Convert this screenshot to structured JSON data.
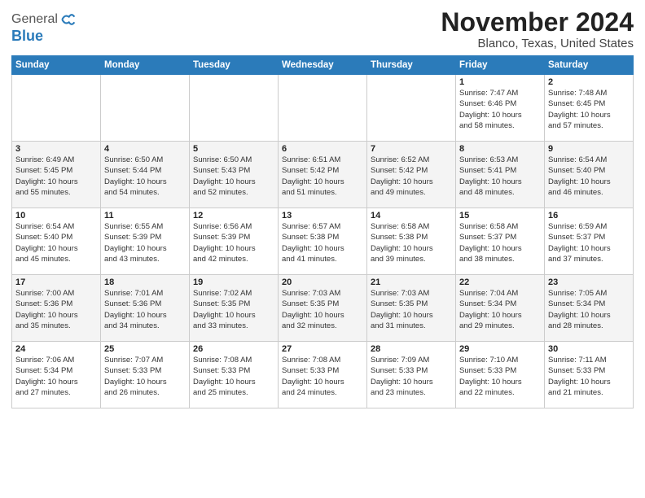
{
  "logo": {
    "general": "General",
    "blue": "Blue"
  },
  "title": "November 2024",
  "subtitle": "Blanco, Texas, United States",
  "headers": [
    "Sunday",
    "Monday",
    "Tuesday",
    "Wednesday",
    "Thursday",
    "Friday",
    "Saturday"
  ],
  "weeks": [
    [
      {
        "day": "",
        "info": ""
      },
      {
        "day": "",
        "info": ""
      },
      {
        "day": "",
        "info": ""
      },
      {
        "day": "",
        "info": ""
      },
      {
        "day": "",
        "info": ""
      },
      {
        "day": "1",
        "info": "Sunrise: 7:47 AM\nSunset: 6:46 PM\nDaylight: 10 hours\nand 58 minutes."
      },
      {
        "day": "2",
        "info": "Sunrise: 7:48 AM\nSunset: 6:45 PM\nDaylight: 10 hours\nand 57 minutes."
      }
    ],
    [
      {
        "day": "3",
        "info": "Sunrise: 6:49 AM\nSunset: 5:45 PM\nDaylight: 10 hours\nand 55 minutes."
      },
      {
        "day": "4",
        "info": "Sunrise: 6:50 AM\nSunset: 5:44 PM\nDaylight: 10 hours\nand 54 minutes."
      },
      {
        "day": "5",
        "info": "Sunrise: 6:50 AM\nSunset: 5:43 PM\nDaylight: 10 hours\nand 52 minutes."
      },
      {
        "day": "6",
        "info": "Sunrise: 6:51 AM\nSunset: 5:42 PM\nDaylight: 10 hours\nand 51 minutes."
      },
      {
        "day": "7",
        "info": "Sunrise: 6:52 AM\nSunset: 5:42 PM\nDaylight: 10 hours\nand 49 minutes."
      },
      {
        "day": "8",
        "info": "Sunrise: 6:53 AM\nSunset: 5:41 PM\nDaylight: 10 hours\nand 48 minutes."
      },
      {
        "day": "9",
        "info": "Sunrise: 6:54 AM\nSunset: 5:40 PM\nDaylight: 10 hours\nand 46 minutes."
      }
    ],
    [
      {
        "day": "10",
        "info": "Sunrise: 6:54 AM\nSunset: 5:40 PM\nDaylight: 10 hours\nand 45 minutes."
      },
      {
        "day": "11",
        "info": "Sunrise: 6:55 AM\nSunset: 5:39 PM\nDaylight: 10 hours\nand 43 minutes."
      },
      {
        "day": "12",
        "info": "Sunrise: 6:56 AM\nSunset: 5:39 PM\nDaylight: 10 hours\nand 42 minutes."
      },
      {
        "day": "13",
        "info": "Sunrise: 6:57 AM\nSunset: 5:38 PM\nDaylight: 10 hours\nand 41 minutes."
      },
      {
        "day": "14",
        "info": "Sunrise: 6:58 AM\nSunset: 5:38 PM\nDaylight: 10 hours\nand 39 minutes."
      },
      {
        "day": "15",
        "info": "Sunrise: 6:58 AM\nSunset: 5:37 PM\nDaylight: 10 hours\nand 38 minutes."
      },
      {
        "day": "16",
        "info": "Sunrise: 6:59 AM\nSunset: 5:37 PM\nDaylight: 10 hours\nand 37 minutes."
      }
    ],
    [
      {
        "day": "17",
        "info": "Sunrise: 7:00 AM\nSunset: 5:36 PM\nDaylight: 10 hours\nand 35 minutes."
      },
      {
        "day": "18",
        "info": "Sunrise: 7:01 AM\nSunset: 5:36 PM\nDaylight: 10 hours\nand 34 minutes."
      },
      {
        "day": "19",
        "info": "Sunrise: 7:02 AM\nSunset: 5:35 PM\nDaylight: 10 hours\nand 33 minutes."
      },
      {
        "day": "20",
        "info": "Sunrise: 7:03 AM\nSunset: 5:35 PM\nDaylight: 10 hours\nand 32 minutes."
      },
      {
        "day": "21",
        "info": "Sunrise: 7:03 AM\nSunset: 5:35 PM\nDaylight: 10 hours\nand 31 minutes."
      },
      {
        "day": "22",
        "info": "Sunrise: 7:04 AM\nSunset: 5:34 PM\nDaylight: 10 hours\nand 29 minutes."
      },
      {
        "day": "23",
        "info": "Sunrise: 7:05 AM\nSunset: 5:34 PM\nDaylight: 10 hours\nand 28 minutes."
      }
    ],
    [
      {
        "day": "24",
        "info": "Sunrise: 7:06 AM\nSunset: 5:34 PM\nDaylight: 10 hours\nand 27 minutes."
      },
      {
        "day": "25",
        "info": "Sunrise: 7:07 AM\nSunset: 5:33 PM\nDaylight: 10 hours\nand 26 minutes."
      },
      {
        "day": "26",
        "info": "Sunrise: 7:08 AM\nSunset: 5:33 PM\nDaylight: 10 hours\nand 25 minutes."
      },
      {
        "day": "27",
        "info": "Sunrise: 7:08 AM\nSunset: 5:33 PM\nDaylight: 10 hours\nand 24 minutes."
      },
      {
        "day": "28",
        "info": "Sunrise: 7:09 AM\nSunset: 5:33 PM\nDaylight: 10 hours\nand 23 minutes."
      },
      {
        "day": "29",
        "info": "Sunrise: 7:10 AM\nSunset: 5:33 PM\nDaylight: 10 hours\nand 22 minutes."
      },
      {
        "day": "30",
        "info": "Sunrise: 7:11 AM\nSunset: 5:33 PM\nDaylight: 10 hours\nand 21 minutes."
      }
    ]
  ]
}
